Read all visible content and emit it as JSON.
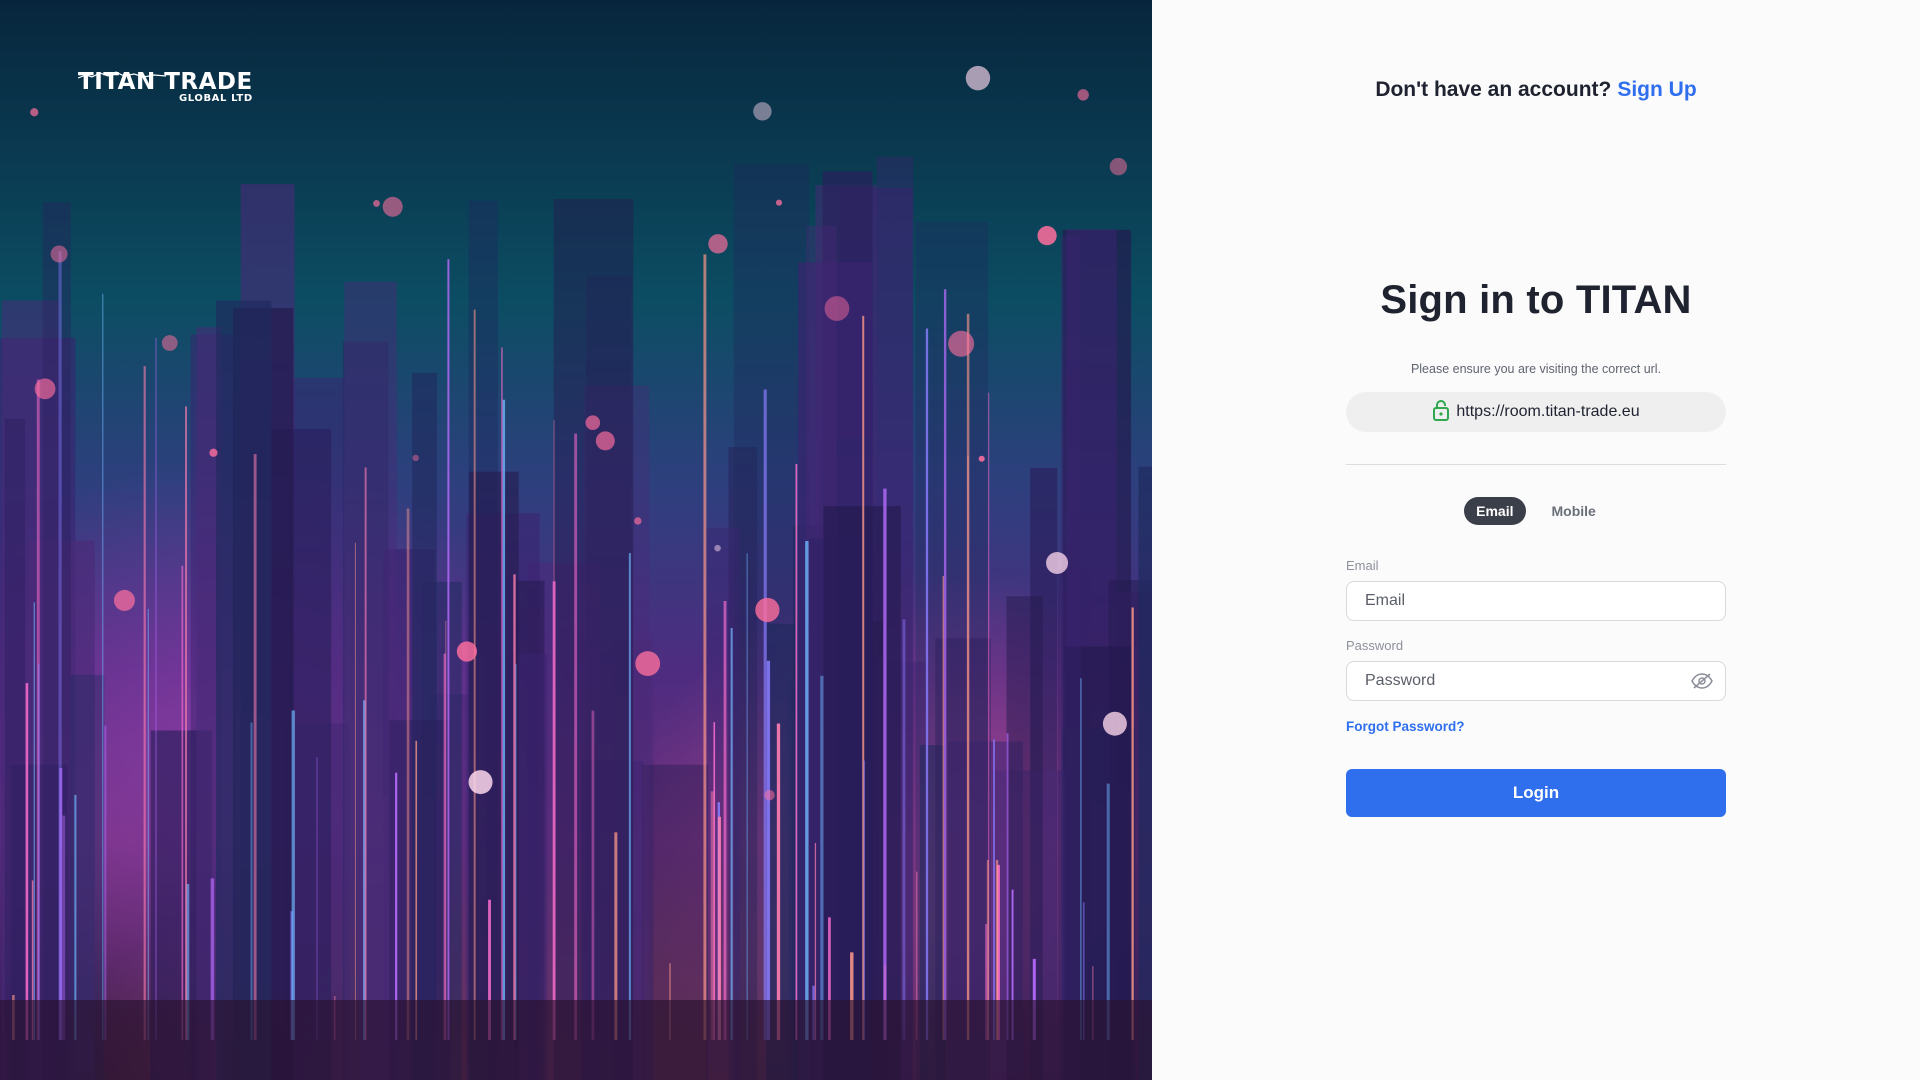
{
  "brand": {
    "name": "TITAN TRADE",
    "sub": "GLOBAL LTD"
  },
  "header": {
    "signup_prompt": "Don't have an account?",
    "signup_link": "Sign Up"
  },
  "login": {
    "title": "Sign in to TITAN",
    "notice": "Please ensure you are visiting the correct url.",
    "url": "https://room.titan-trade.eu",
    "tabs": [
      "Email",
      "Mobile"
    ],
    "active_tab": "Email",
    "email_label": "Email",
    "email_placeholder": "Email",
    "password_label": "Password",
    "password_placeholder": "Password",
    "forgot_link": "Forgot Password?",
    "login_button": "Login"
  },
  "colors": {
    "accent": "#2f6fee",
    "text_dark": "#1f2330",
    "tab_active_bg": "#3b3f4a",
    "lock_icon": "#2fa84f"
  },
  "icons": {
    "url_pill": "lock-icon",
    "password_toggle": "eye-off-icon"
  }
}
